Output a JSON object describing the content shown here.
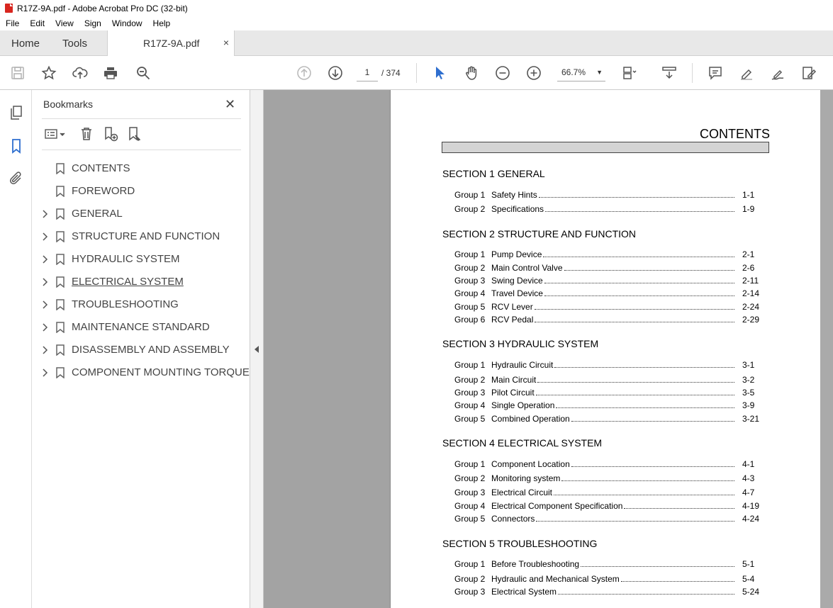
{
  "window": {
    "title": "R17Z-9A.pdf - Adobe Acrobat Pro DC (32-bit)"
  },
  "menu": [
    "File",
    "Edit",
    "View",
    "Sign",
    "Window",
    "Help"
  ],
  "tabs": {
    "home": "Home",
    "tools": "Tools",
    "document": "R17Z-9A.pdf",
    "close": "×"
  },
  "toolbar": {
    "page_current": "1",
    "page_total": "/ 374",
    "zoom": "66.7%"
  },
  "bookmarks": {
    "title": "Bookmarks",
    "close": "✕",
    "items": [
      {
        "label": "CONTENTS",
        "expandable": false
      },
      {
        "label": "FOREWORD",
        "expandable": false
      },
      {
        "label": "GENERAL",
        "expandable": true
      },
      {
        "label": "STRUCTURE AND FUNCTION",
        "expandable": true
      },
      {
        "label": "HYDRAULIC SYSTEM",
        "expandable": true
      },
      {
        "label": "ELECTRICAL SYSTEM",
        "expandable": true
      },
      {
        "label": "TROUBLESHOOTING",
        "expandable": true
      },
      {
        "label": "MAINTENANCE STANDARD",
        "expandable": true
      },
      {
        "label": "DISASSEMBLY AND ASSEMBLY",
        "expandable": true
      },
      {
        "label": "COMPONENT MOUNTING TORQUE",
        "expandable": true
      }
    ]
  },
  "document": {
    "title": "CONTENTS",
    "sections": [
      {
        "heading": "SECTION 1  GENERAL",
        "entries": [
          {
            "group": "Group  1",
            "title": "Safety Hints",
            "page": "1-1"
          },
          {
            "group": "Group  2",
            "title": "Specifications",
            "page": "1-9"
          }
        ]
      },
      {
        "heading": "SECTION 2  STRUCTURE AND FUNCTION",
        "entries": [
          {
            "group": "Group  1",
            "title": "Pump Device",
            "page": "2-1"
          },
          {
            "group": "Group  2",
            "title": "Main Control Valve",
            "page": "2-6"
          },
          {
            "group": "Group  3",
            "title": "Swing Device",
            "page": "2-11"
          },
          {
            "group": "Group  4",
            "title": "Travel Device",
            "page": "2-14"
          },
          {
            "group": "Group  5",
            "title": "RCV Lever",
            "page": "2-24"
          },
          {
            "group": "Group  6",
            "title": "RCV Pedal",
            "page": "2-29"
          }
        ]
      },
      {
        "heading": "SECTION 3  HYDRAULIC SYSTEM",
        "entries": [
          {
            "group": "Group  1",
            "title": "Hydraulic Circuit",
            "page": "3-1"
          },
          {
            "group": "Group  2",
            "title": "Main Circuit",
            "page": "3-2"
          },
          {
            "group": "Group  3",
            "title": "Pilot Circuit",
            "page": "3-5"
          },
          {
            "group": "Group  4",
            "title": "Single Operation",
            "page": "3-9"
          },
          {
            "group": "Group  5",
            "title": "Combined Operation",
            "page": "3-21"
          }
        ]
      },
      {
        "heading": "SECTION 4  ELECTRICAL SYSTEM",
        "entries": [
          {
            "group": "Group  1",
            "title": "Component Location",
            "page": "4-1"
          },
          {
            "group": "Group  2",
            "title": "Monitoring system",
            "page": "4-3"
          },
          {
            "group": "Group  3",
            "title": "Electrical Circuit",
            "page": "4-7"
          },
          {
            "group": "Group  4",
            "title": "Electrical Component Specification",
            "page": "4-19"
          },
          {
            "group": "Group  5",
            "title": "Connectors",
            "page": "4-24"
          }
        ]
      },
      {
        "heading": "SECTION 5  TROUBLESHOOTING",
        "entries": [
          {
            "group": "Group  1",
            "title": "Before Troubleshooting",
            "page": "5-1"
          },
          {
            "group": "Group  2",
            "title": "Hydraulic and Mechanical System",
            "page": "5-4"
          },
          {
            "group": "Group  3",
            "title": "Electrical System",
            "page": "5-24"
          }
        ]
      }
    ]
  }
}
